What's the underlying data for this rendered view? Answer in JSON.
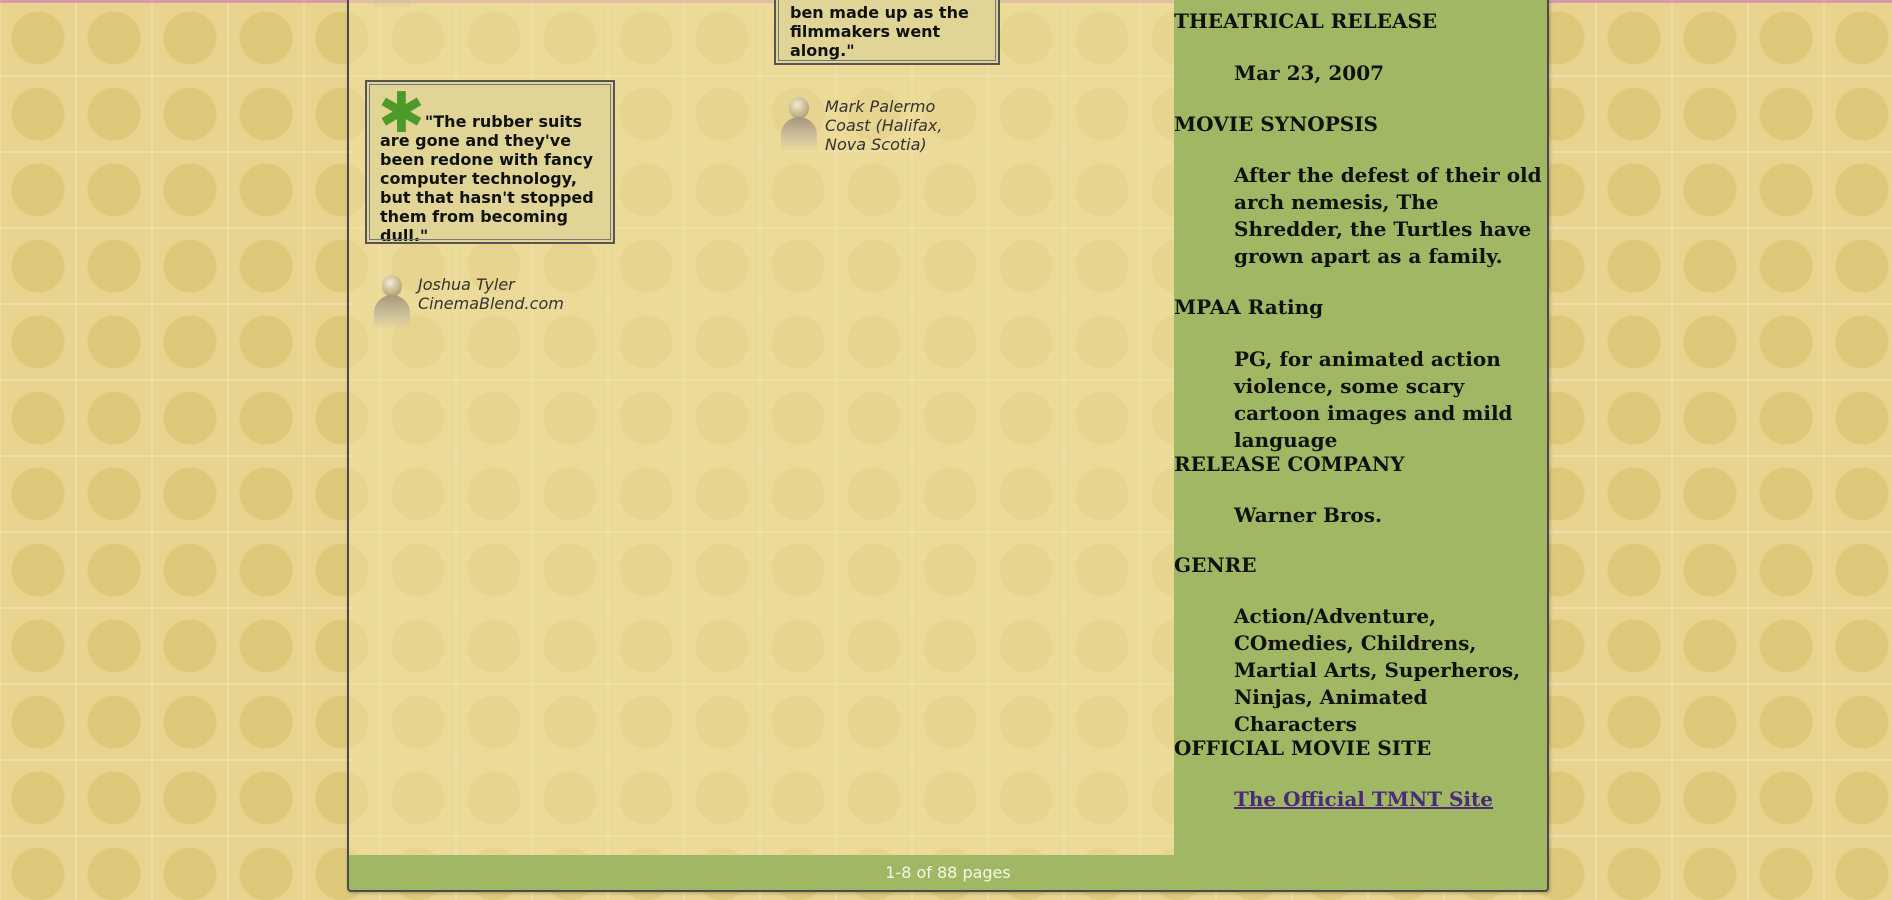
{
  "reviews": {
    "top_quote": "ben made up as the filmmakers went along.\"",
    "main_quote": "\"The rubber suits are gone and they've been redone with fancy computer technology, but that hasn't stopped them from becoming dull.\"",
    "asterisk_icon": "fresh-splat-icon",
    "reviewer_mark": {
      "name": "Mark Palermo",
      "outlet": "Coast (Halifax, Nova Scotia)"
    },
    "reviewer_joshua": {
      "name": "Joshua Tyler",
      "outlet": "CinemaBlend.com"
    }
  },
  "sidebar": {
    "theatrical_release_heading": "THEATRICAL RELEASE",
    "theatrical_release_value": "Mar 23, 2007",
    "synopsis_heading": "MOVIE SYNOPSIS",
    "synopsis_value": "After the defest of their old arch nemesis, The Shredder, the Turtles have grown apart as a family.",
    "mpaa_heading": "MPAA Rating",
    "mpaa_value": "PG, for animated action violence, some scary cartoon images and mild language",
    "release_company_heading": "RELEASE COMPANY",
    "release_company_value": "Warner Bros.",
    "genre_heading": "GENRE",
    "genre_value": "Action/Adventure, COmedies, Childrens, Martial Arts, Superheros, Ninjas, Animated Characters",
    "official_site_heading": "OFFICIAL MOVIE SITE",
    "official_site_link": "The Official TMNT Site"
  },
  "footer": {
    "pages_text": "1-8 of 88 pages"
  },
  "colors": {
    "background": "#e8d48e",
    "sidebar": "#a0b864",
    "link": "#4b2a7a",
    "asterisk": "#4d9a2a"
  }
}
